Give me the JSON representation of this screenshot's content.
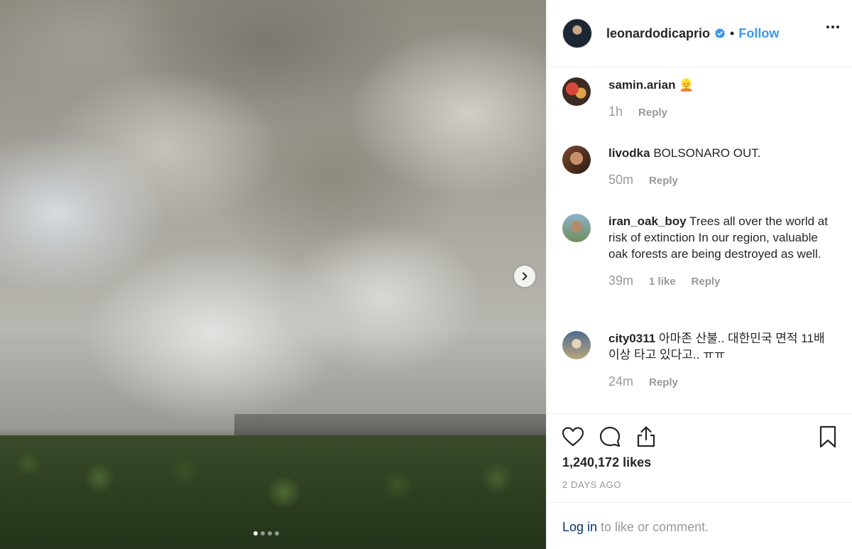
{
  "post": {
    "photo_alt": "",
    "carousel": {
      "count": 4,
      "active_index": 0
    }
  },
  "header": {
    "username": "leonardodicaprio",
    "separator": "•",
    "follow_label": "Follow"
  },
  "comments": [
    {
      "user": "samin.arian",
      "text": "👱",
      "time": "1h",
      "likes": "",
      "reply": "Reply"
    },
    {
      "user": "livodka",
      "text": "BOLSONARO OUT.",
      "time": "50m",
      "likes": "",
      "reply": "Reply"
    },
    {
      "user": "iran_oak_boy",
      "text": "Trees all over the world at risk of extinction In our region, valuable oak forests are being destroyed as well.",
      "time": "39m",
      "likes": "1 like",
      "reply": "Reply"
    },
    {
      "user": "city0311",
      "text": "아마존 산불.. 대한민국 면적 11배 이상 타고 있다고.. ㅠㅠ",
      "time": "24m",
      "likes": "",
      "reply": "Reply"
    }
  ],
  "stats": {
    "likes": "1,240,172 likes",
    "posted": "2 DAYS AGO"
  },
  "footer": {
    "login_link": "Log in",
    "login_rest": " to like or comment."
  },
  "colors": {
    "link_blue": "#3897f0",
    "text_dark": "#262626",
    "text_muted": "#999999"
  }
}
